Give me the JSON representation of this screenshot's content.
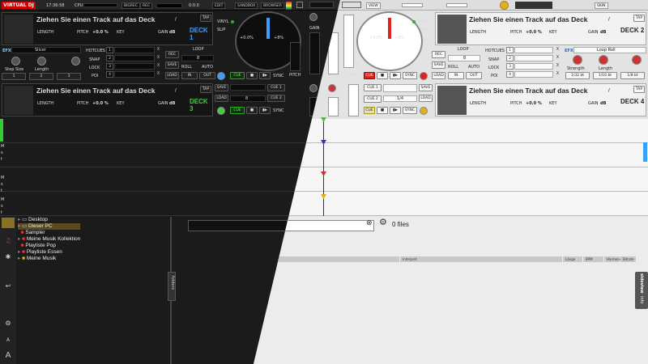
{
  "topbar": {
    "logo": "VIRTUAL DJ",
    "time": "17:36:58",
    "cpu": "CPU",
    "rec_label": "REC",
    "bigrec": "BIGREC",
    "counter": "0:0.0",
    "edit": "EDIT",
    "sandbox": "SANDBOX",
    "browser": "BROWSER",
    "view": "VIEW",
    "rhythm": "RHYTHM",
    "scratch": "SCRATCH",
    "master": "MASTER",
    "bal": "BAL",
    "skin": "SKIN"
  },
  "deck_common": {
    "title": "Ziehen Sie einen Track auf das Deck",
    "slash": "/",
    "tap": "TAP",
    "length": "LENGTH",
    "pitch": "PITCH",
    "pitch_val": "+0.0 %",
    "key": "KEY",
    "gain": "GAIN",
    "db": "dB",
    "vinyl": "VINYL",
    "slip": "SLIP",
    "jog_left": "+0.0%",
    "jog_right": "+8%",
    "cue": "CUE",
    "sync": "SYNC",
    "stop": "■",
    "play": "▮▶",
    "loop": "LOOP",
    "rec": "REC",
    "save": "SAVE",
    "load": "LOAD",
    "in": "IN",
    "out": "OUT",
    "roll": "ROLL",
    "auto": "AUTO",
    "loop_len": "8",
    "hotcues": "HOTCUES",
    "snap": "SNAP",
    "lock": "LOCK",
    "poi": "POI",
    "pitch_label": "PITCH",
    "gain_label": "GAIN",
    "x": "X"
  },
  "deck1": {
    "label": "DECK 1",
    "color": "#3aa0ff"
  },
  "deck2": {
    "label": "DECK 2",
    "color": "#000000"
  },
  "deck3": {
    "label": "DECK 3",
    "color": "#44cc44",
    "cue1": "CUE 1",
    "cue2": "CUE 2",
    "loop_val": "8",
    "loop_frac": "1/4"
  },
  "deck4": {
    "label": "DECK 4",
    "color": "#000000",
    "cue1": "CUE 1",
    "cue2": "CUE 2",
    "loop_val": "1/4"
  },
  "fx_left": {
    "tag": "EFX",
    "name": "Slicer",
    "p1": "Step Size",
    "p2": "Length",
    "v1": "1",
    "v2": "2",
    "v3": "3"
  },
  "fx_right": {
    "tag": "EFX",
    "name": "Loop Roll",
    "p1": "Strength",
    "p2": "Length",
    "v1": "1/32 bt",
    "v2": "1/16 bt",
    "v3": "1/8 bt"
  },
  "hotcue_nums": [
    "1",
    "2",
    "3",
    "4"
  ],
  "waveform_labels": [
    "M",
    "s",
    "t",
    "M",
    "s",
    "t",
    "M",
    "s",
    "t"
  ],
  "browser": {
    "tree": [
      {
        "icon": "folder",
        "label": "Desktop"
      },
      {
        "icon": "pc",
        "label": "Dieser PC"
      },
      {
        "icon": "sampler",
        "label": "Sampler"
      },
      {
        "icon": "list",
        "label": "Meine Musik Kollektion"
      },
      {
        "icon": "list",
        "label": "Playliste Pop"
      },
      {
        "icon": "list",
        "label": "Playliste Essen"
      },
      {
        "icon": "music",
        "label": "Meine Musik"
      }
    ],
    "files": "0 files",
    "columns": [
      "Titel",
      "Interpret",
      "Länge",
      "BPM",
      "Harmonic",
      "Bitrate"
    ],
    "folders_tab": "folders",
    "sideview_tab": "sideview",
    "info_tab": "info",
    "side_a1": "A",
    "side_a2": "A"
  }
}
